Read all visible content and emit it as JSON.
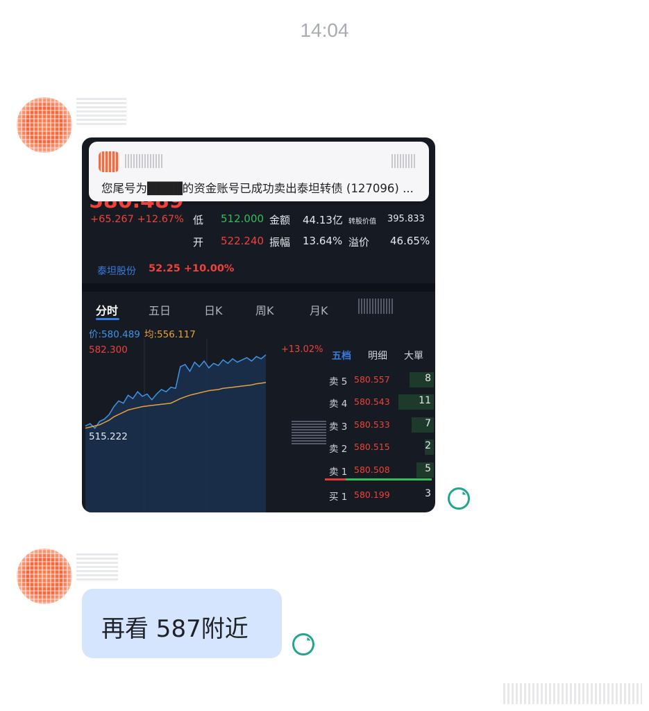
{
  "time": "14:04",
  "message1": {
    "notification": {
      "text": "您尾号为████的资金账号已成功卖出泰坦转债 (127096) ..."
    },
    "quote": {
      "price_partial": "580.489",
      "change": "+65.267 +12.67%",
      "row1": {
        "l1": "低",
        "v1": "512.000",
        "l2": "金额",
        "v2": "44.13亿",
        "l3": "转股价值",
        "v3": "395.833"
      },
      "row2": {
        "l1": "开",
        "v1": "522.240",
        "l2": "振幅",
        "v2": "13.64%",
        "l3": "溢价",
        "v3": "46.65%"
      },
      "stock": {
        "name": "泰坦股份",
        "value": "52.25 +10.00%"
      }
    },
    "tabs": [
      {
        "label": "分时",
        "active": true
      },
      {
        "label": "五日"
      },
      {
        "label": "日K"
      },
      {
        "label": "周K"
      },
      {
        "label": "月K"
      }
    ],
    "chart": {
      "legend_price": "价:580.489",
      "legend_avg": "均:556.117",
      "high_label": "582.300",
      "low_label": "515.222",
      "pct_label": "+13.02%"
    },
    "chart_data": {
      "type": "line",
      "title": "",
      "ylim": [
        515.222,
        582.3
      ],
      "series": [
        {
          "name": "价",
          "values": [
            518,
            520,
            516,
            522,
            524,
            528,
            535,
            540,
            538,
            545,
            542,
            548,
            544,
            546,
            541,
            546,
            550,
            548,
            552,
            551,
            570,
            572,
            566,
            574,
            570,
            575,
            569,
            573,
            571,
            576,
            573,
            577,
            574,
            576,
            578,
            575,
            579,
            577,
            580.489
          ]
        },
        {
          "name": "均",
          "values": [
            516,
            517,
            518,
            519,
            521,
            523,
            526,
            528,
            530,
            532,
            533,
            534,
            535,
            535.5,
            536,
            536.5,
            537,
            537.5,
            538,
            540,
            542,
            543.5,
            545,
            546,
            547,
            548,
            549,
            549.5,
            550,
            551,
            551.5,
            552,
            552.5,
            553,
            553.5,
            554,
            555,
            555.5,
            556.117
          ]
        }
      ],
      "colors": {
        "price": "#3f95e6",
        "avg": "#e7a33b",
        "fill": "#1a3150"
      }
    },
    "orderbook": {
      "tabs": [
        "五档",
        "明细",
        "大單"
      ],
      "rows": [
        {
          "label": "卖 5",
          "price": "580.557",
          "vol": "8",
          "bar": 0.22
        },
        {
          "label": "卖 4",
          "price": "580.543",
          "vol": "11",
          "bar": 0.32
        },
        {
          "label": "卖 3",
          "price": "580.533",
          "vol": "7",
          "bar": 0.2
        },
        {
          "label": "卖 2",
          "price": "580.515",
          "vol": "2",
          "bar": 0.08
        },
        {
          "label": "卖 1",
          "price": "580.508",
          "vol": "5",
          "bar": 0.16
        },
        {
          "label": "买 1",
          "price": "580.199",
          "vol": "3",
          "bar": 0.0
        }
      ]
    }
  },
  "message2": {
    "text": "再看 587附近"
  }
}
